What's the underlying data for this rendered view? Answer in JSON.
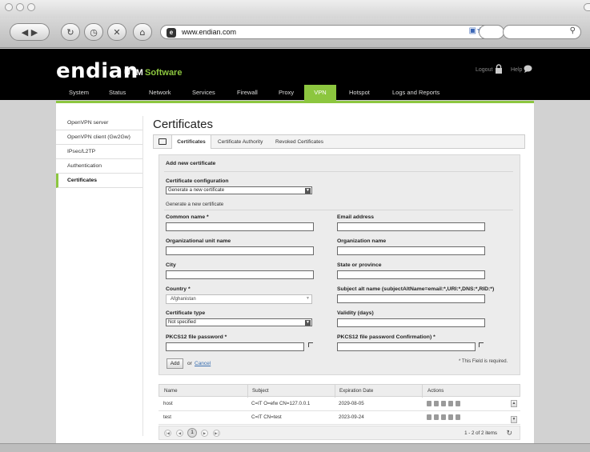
{
  "browser": {
    "url": "www.endian.com",
    "favicon": "e"
  },
  "header": {
    "logo": "endian",
    "logo_utm": "UTM",
    "logo_software": "Software",
    "logout": "Logout",
    "help": "Help"
  },
  "nav": {
    "items": [
      "System",
      "Status",
      "Network",
      "Services",
      "Firewall",
      "Proxy",
      "VPN",
      "Hotspot",
      "Logs and Reports"
    ],
    "active": "VPN",
    "accent_color": "#8cc63f"
  },
  "sidebar": {
    "items": [
      "OpenVPN server",
      "OpenVPN client (Gw2Gw)",
      "IPsec/L2TP",
      "Authentication",
      "Certificates"
    ],
    "active": "Certificates"
  },
  "page": {
    "title": "Certificates",
    "tabs": [
      "Certificates",
      "Certificate Authority",
      "Revoked Certificates"
    ],
    "active_tab": "Certificates"
  },
  "form": {
    "heading": "Add new certificate",
    "config_label": "Certificate configuration",
    "config_value": "Generate a new certificate",
    "sub_heading": "Generate a new certificate",
    "common_name": "Common name *",
    "email": "Email address",
    "org_unit": "Organizational unit name",
    "org_name": "Organization name",
    "city": "City",
    "state": "State or province",
    "country": "Country *",
    "country_value": "Afghanistan",
    "subject_alt": "Subject alt name (subjectAltName=email:*,URI:*,DNS:*,RID:*)",
    "cert_type": "Certificate type",
    "cert_type_value": "Not specified",
    "validity": "Validity (days)",
    "pkcs_password": "PKCS12 file password *",
    "pkcs_confirm": "PKCS12 file password Confirmation) *",
    "add_button": "Add",
    "or_text": "or",
    "cancel_link": "Cancel",
    "required_note": "* This Field is required."
  },
  "table": {
    "columns": [
      "Name",
      "Subject",
      "Expiration Date",
      "Actions"
    ],
    "rows": [
      {
        "name": "host",
        "subject": "C=IT O=efw CN=127.0.0.1",
        "expiration": "2029-08-05"
      },
      {
        "name": "test",
        "subject": "C=IT CN=test",
        "expiration": "2023-09-24"
      }
    ],
    "page": "1",
    "pager_info": "1 - 2 of 2 items"
  }
}
